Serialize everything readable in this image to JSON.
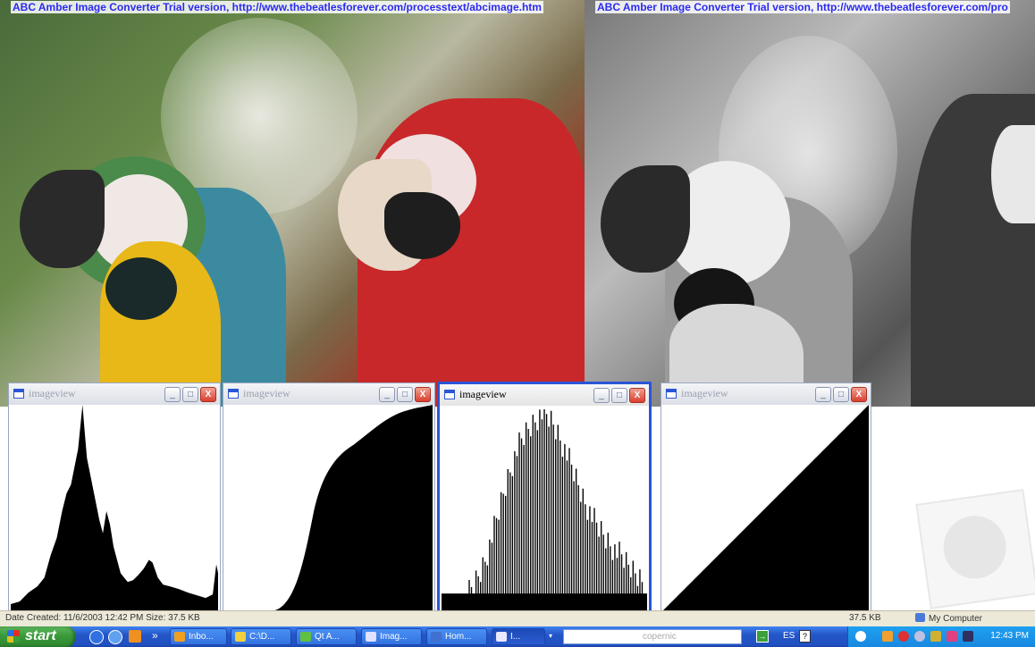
{
  "images": {
    "watermark_left": "ABC Amber Image Converter Trial version, http://www.thebeatlesforever.com/processtext/abcimage.htm",
    "watermark_right": "ABC Amber Image Converter Trial version, http://www.thebeatlesforever.com/pro"
  },
  "windows": [
    {
      "title": "imageview",
      "active": false
    },
    {
      "title": "imageview",
      "active": false
    },
    {
      "title": "imageview",
      "active": true
    },
    {
      "title": "imageview",
      "active": false
    }
  ],
  "window_buttons": {
    "minimize": "_",
    "maximize": "□",
    "close": "X"
  },
  "statusbar": {
    "left": "Date Created: 11/6/2003 12:42 PM Size: 37.5 KB",
    "size": "37.5 KB",
    "zone": "My Computer"
  },
  "taskbar": {
    "start": "start",
    "chevron": "»",
    "buttons": [
      {
        "label": "Inbo...",
        "icon_color": "#f0a020"
      },
      {
        "label": "C:\\D...",
        "icon_color": "#f0d040"
      },
      {
        "label": "Qt A...",
        "icon_color": "#60c040"
      },
      {
        "label": "Imag...",
        "icon_color": "#e0e0ff"
      },
      {
        "label": "Hom...",
        "icon_color": "#4070d0"
      },
      {
        "label": "I...",
        "icon_color": "#e8e8ff"
      }
    ],
    "search_text": "copernic",
    "language": "ES",
    "help": "?",
    "go": "→",
    "clock": "12:43 PM"
  }
}
